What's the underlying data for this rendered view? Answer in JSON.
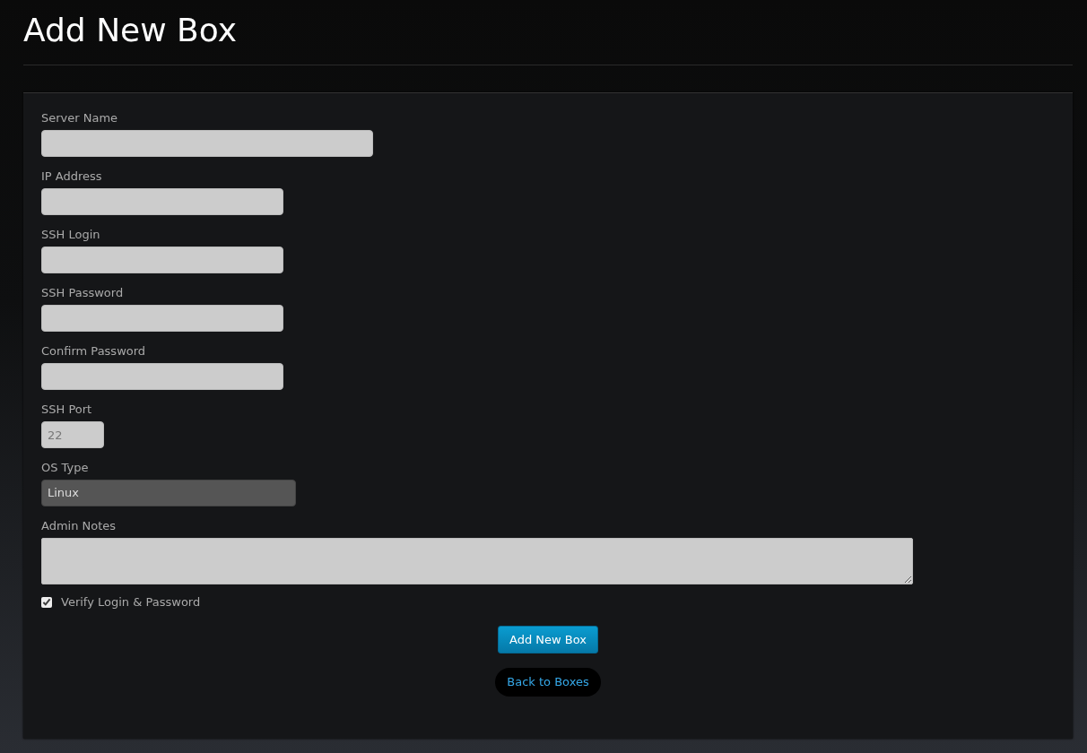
{
  "title": "Add New Box",
  "fields": [
    {
      "label": "Server Name",
      "kind": "longtext"
    },
    {
      "label": "IP Address",
      "kind": "text"
    },
    {
      "label": "SSH Login",
      "kind": "text"
    },
    {
      "label": "SSH Password",
      "kind": "password"
    },
    {
      "label": "Confirm Password",
      "kind": "password"
    },
    {
      "label": "SSH Port",
      "kind": "number",
      "placeholder": "22"
    },
    {
      "label": "OS Type",
      "kind": "select",
      "value": "Linux"
    },
    {
      "label": "Admin Notes",
      "kind": "textarea"
    }
  ],
  "verify": {
    "label": "Verify Login & Password",
    "checked": true
  },
  "submit_button": "Add New Box",
  "back_link": "Back to Boxes"
}
